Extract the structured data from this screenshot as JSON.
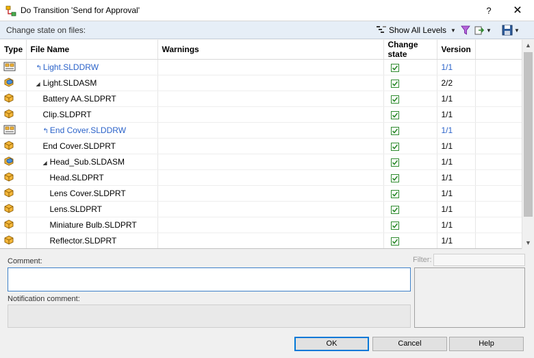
{
  "window": {
    "title": "Do Transition 'Send for Approval'",
    "help_label": "?",
    "close_label": "✕"
  },
  "toolbar": {
    "label": "Change state on files:",
    "levels_label": "Show All Levels"
  },
  "table": {
    "headers": {
      "type": "Type",
      "file_name": "File Name",
      "warnings": "Warnings",
      "change_state": "Change state",
      "version": "Version"
    },
    "rows": [
      {
        "icon": "drawing-icon",
        "indent": 0,
        "ref": true,
        "expander": "",
        "name": "Light.SLDDRW",
        "warnings": "",
        "checked": true,
        "version": "1/1",
        "link": true
      },
      {
        "icon": "assembly-icon",
        "indent": 0,
        "ref": false,
        "expander": "◢",
        "name": "Light.SLDASM",
        "warnings": "",
        "checked": true,
        "version": "2/2",
        "link": false
      },
      {
        "icon": "part-icon",
        "indent": 1,
        "ref": false,
        "expander": "",
        "name": "Battery AA.SLDPRT",
        "warnings": "",
        "checked": true,
        "version": "1/1",
        "link": false
      },
      {
        "icon": "part-icon",
        "indent": 1,
        "ref": false,
        "expander": "",
        "name": "Clip.SLDPRT",
        "warnings": "",
        "checked": true,
        "version": "1/1",
        "link": false
      },
      {
        "icon": "drawing-icon",
        "indent": 1,
        "ref": true,
        "expander": "",
        "name": "End Cover.SLDDRW",
        "warnings": "",
        "checked": true,
        "version": "1/1",
        "link": true
      },
      {
        "icon": "part-icon",
        "indent": 1,
        "ref": false,
        "expander": "",
        "name": "End Cover.SLDPRT",
        "warnings": "",
        "checked": true,
        "version": "1/1",
        "link": false
      },
      {
        "icon": "assembly-icon",
        "indent": 1,
        "ref": false,
        "expander": "◢",
        "name": "Head_Sub.SLDASM",
        "warnings": "",
        "checked": true,
        "version": "1/1",
        "link": false
      },
      {
        "icon": "part-icon",
        "indent": 2,
        "ref": false,
        "expander": "",
        "name": "Head.SLDPRT",
        "warnings": "",
        "checked": true,
        "version": "1/1",
        "link": false
      },
      {
        "icon": "part-icon",
        "indent": 2,
        "ref": false,
        "expander": "",
        "name": "Lens Cover.SLDPRT",
        "warnings": "",
        "checked": true,
        "version": "1/1",
        "link": false
      },
      {
        "icon": "part-icon",
        "indent": 2,
        "ref": false,
        "expander": "",
        "name": "Lens.SLDPRT",
        "warnings": "",
        "checked": true,
        "version": "1/1",
        "link": false
      },
      {
        "icon": "part-icon",
        "indent": 2,
        "ref": false,
        "expander": "",
        "name": "Miniature Bulb.SLDPRT",
        "warnings": "",
        "checked": true,
        "version": "1/1",
        "link": false
      },
      {
        "icon": "part-icon",
        "indent": 2,
        "ref": false,
        "expander": "",
        "name": "Reflector.SLDPRT",
        "warnings": "",
        "checked": true,
        "version": "1/1",
        "link": false
      }
    ]
  },
  "comment": {
    "label": "Comment:",
    "value": ""
  },
  "notification": {
    "label": "Notification comment:",
    "value": ""
  },
  "filter": {
    "label": "Filter:",
    "value": ""
  },
  "buttons": {
    "ok": "OK",
    "cancel": "Cancel",
    "help": "Help"
  },
  "colors": {
    "link": "#2a62c9",
    "accent": "#0078d7",
    "check": "#2e8b2e"
  }
}
